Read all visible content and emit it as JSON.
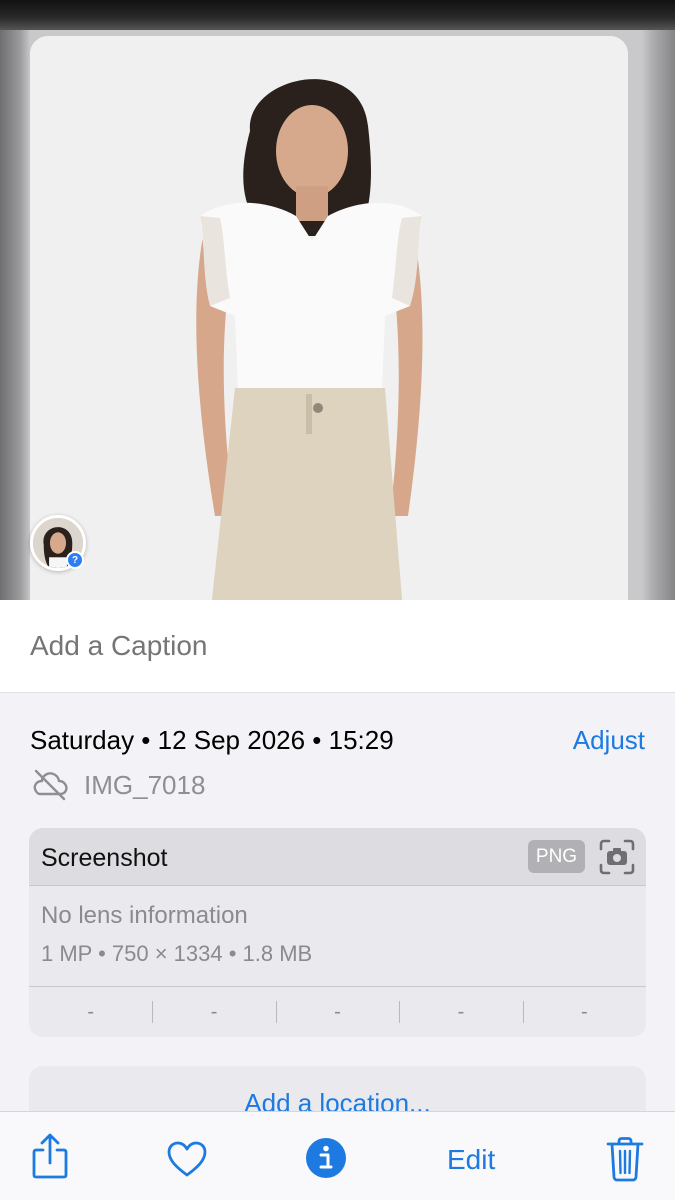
{
  "photo": {
    "face_badge_mark": "?"
  },
  "caption": {
    "placeholder": "Add a Caption"
  },
  "info": {
    "date_line": "Saturday • 12 Sep 2026 • 15:29",
    "adjust_label": "Adjust",
    "file_name": "IMG_7018",
    "cloud_icon": "cloud-slash-icon"
  },
  "meta": {
    "title": "Screenshot",
    "format_badge": "PNG",
    "shot_icon": "screenshot-camera-icon",
    "lens": "No lens information",
    "specs": "1 MP  •  750 × 1334  •  1.8 MB",
    "cells": [
      "-",
      "-",
      "-",
      "-",
      "-"
    ]
  },
  "location": {
    "label": "Add a location..."
  },
  "toolbar": {
    "share_icon": "share-icon",
    "favorite_icon": "heart-icon",
    "info_icon": "info-icon",
    "edit_label": "Edit",
    "delete_icon": "trash-icon"
  },
  "colors": {
    "accent": "#1c7ae0",
    "secondary_text": "#8e8e93",
    "background": "#f2f2f7"
  }
}
